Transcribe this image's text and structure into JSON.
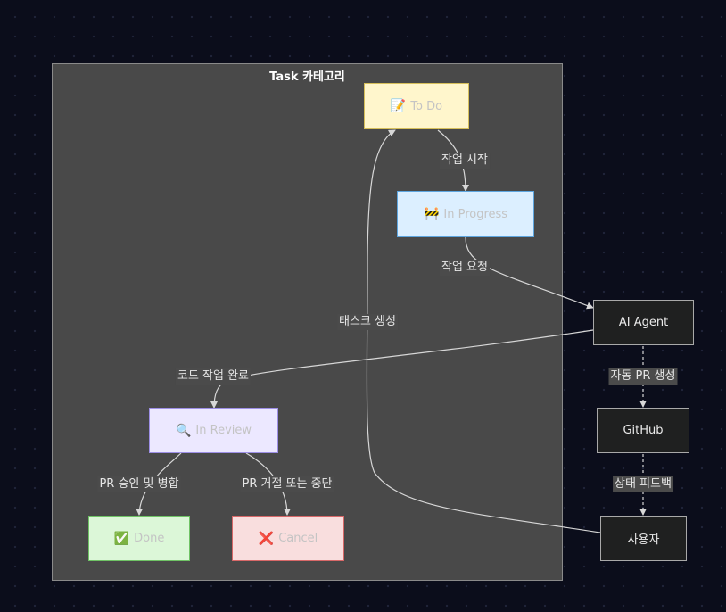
{
  "cluster": {
    "title": "Task 카테고리"
  },
  "nodes": {
    "todo": {
      "icon": "📝",
      "label": "To Do",
      "fill": "#fff6cc",
      "stroke": "#d6bf5a"
    },
    "in_progress": {
      "icon": "🚧",
      "label": "In Progress",
      "fill": "#dcefff",
      "stroke": "#5ea6e0"
    },
    "in_review": {
      "icon": "🔍",
      "label": "In Review",
      "fill": "#ece8ff",
      "stroke": "#9d8fe6"
    },
    "done": {
      "icon": "✅",
      "label": "Done",
      "fill": "#dcf7d8",
      "stroke": "#6fc365"
    },
    "cancel": {
      "icon": "❌",
      "label": "Cancel",
      "fill": "#f9dede",
      "stroke": "#d86868"
    },
    "ai_agent": {
      "label": "AI Agent"
    },
    "github": {
      "label": "GitHub"
    },
    "user": {
      "label": "사용자"
    }
  },
  "edge_labels": {
    "start_work": "작업 시작",
    "request_work": "작업 요청",
    "create_task": "태스크 생성",
    "code_done": "코드 작업 완료",
    "auto_pr": "자동 PR 생성",
    "pr_approve": "PR 승인 및 병합",
    "pr_reject": "PR 거절 또는 중단",
    "status_feedback": "상태 피드백"
  },
  "colors": {
    "background": "#0b0d1b",
    "cluster_fill": "#494949",
    "edge": "#d7d7d7"
  }
}
